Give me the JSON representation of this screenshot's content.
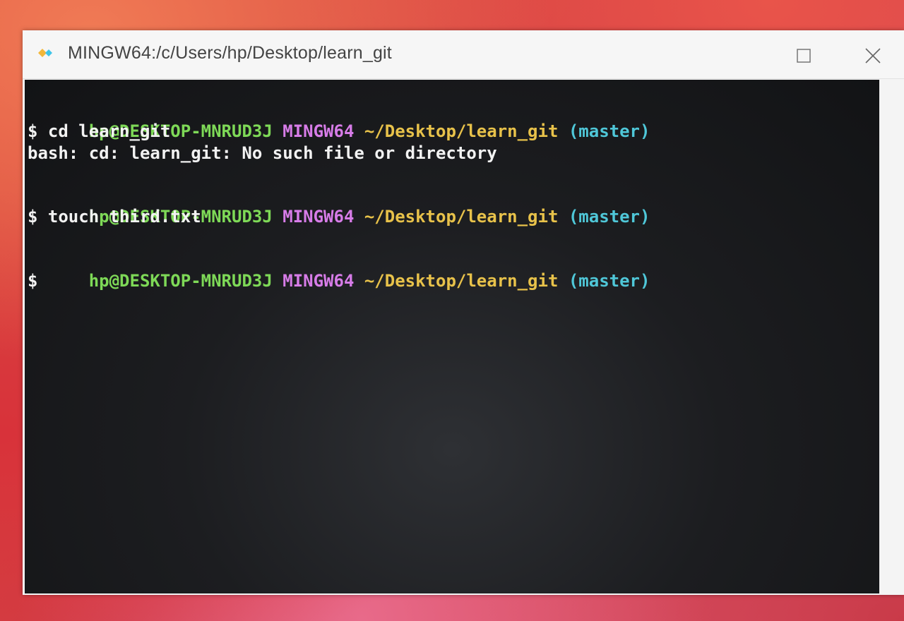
{
  "window": {
    "title": "MINGW64:/c/Users/hp/Desktop/learn_git"
  },
  "icons": {
    "app": "git-bash-icon",
    "maximize": "maximize-icon",
    "close": "close-icon"
  },
  "colors": {
    "user_host": "#7ed957",
    "mingw": "#d77ce8",
    "path": "#e8c24a",
    "branch": "#4fc7d8",
    "text": "#f2f2f2",
    "terminal_bg": "#1c1d20"
  },
  "terminal": {
    "prompts": [
      {
        "user_host": "hp@DESKTOP-MNRUD3J",
        "env": "MINGW64",
        "path": "~/Desktop/learn_git",
        "branch": "(master)",
        "command": "$ cd learn_git",
        "output": "bash: cd: learn_git: No such file or directory"
      },
      {
        "user_host": "hp@DESKTOP-MNRUD3J",
        "env": "MINGW64",
        "path": "~/Desktop/learn_git",
        "branch": "(master)",
        "command": "$ touch third.txt",
        "output": ""
      },
      {
        "user_host": "hp@DESKTOP-MNRUD3J",
        "env": "MINGW64",
        "path": "~/Desktop/learn_git",
        "branch": "(master)",
        "command": "$",
        "output": ""
      }
    ]
  }
}
